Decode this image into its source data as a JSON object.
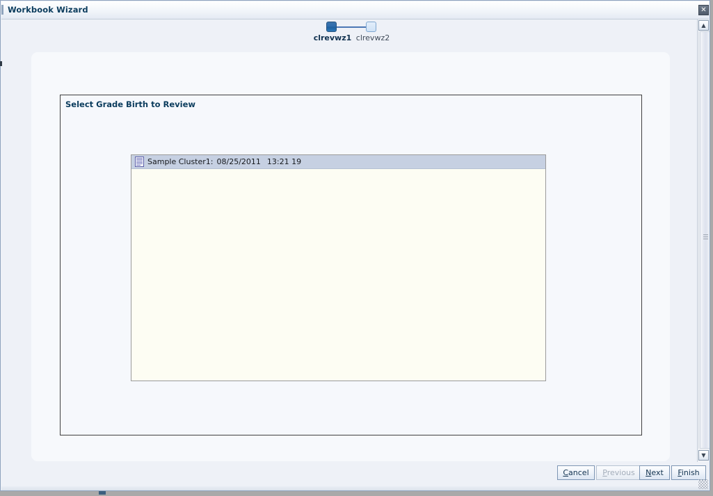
{
  "window": {
    "title": "Workbook Wizard",
    "close_icon": "close-icon",
    "close_glyph": "✕"
  },
  "wizard_train": {
    "steps": [
      {
        "label": "clrevwz1",
        "state": "active"
      },
      {
        "label": "clrevwz2",
        "state": "inactive"
      }
    ]
  },
  "region": {
    "title": "Select Grade Birth to Review"
  },
  "list": {
    "icon": "document-lines-icon",
    "items": [
      {
        "name": "Sample Cluster1:",
        "date": "08/25/2011",
        "time": "13:21 19"
      }
    ]
  },
  "footer": {
    "buttons": [
      {
        "id": "cancel",
        "mnemonic": "C",
        "rest": "ancel",
        "enabled": true
      },
      {
        "id": "previous",
        "mnemonic": "P",
        "rest": "revious",
        "enabled": false
      },
      {
        "id": "next",
        "mnemonic": "N",
        "rest": "ext",
        "enabled": true
      },
      {
        "id": "finish",
        "mnemonic": "F",
        "rest": "inish",
        "enabled": true
      }
    ],
    "cancel_label": "Cancel",
    "previous_label": "Previous",
    "next_label": "Next",
    "finish_label": "Finish"
  },
  "scrollbar": {
    "up_glyph": "▲",
    "down_glyph": "▼"
  },
  "colors": {
    "title_text": "#0b3c5d",
    "accent_blue": "#2f6eae",
    "row_selected": "#c6d0e2",
    "list_background": "#fdfdf3",
    "card_background": "#f7f9fc"
  }
}
